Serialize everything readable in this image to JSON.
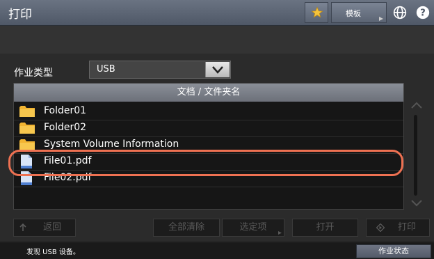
{
  "title": "打印",
  "toolbar": {
    "star_icon": "star-icon",
    "template_label": "模板",
    "globe_icon": "globe-icon",
    "help_icon": "help-icon"
  },
  "job_type": {
    "label": "作业类型",
    "value": "USB"
  },
  "file_list": {
    "header": "文档 / 文件夹名",
    "items": [
      {
        "name": "Folder01",
        "type": "folder"
      },
      {
        "name": "Folder02",
        "type": "folder"
      },
      {
        "name": "System Volume Information",
        "type": "folder"
      },
      {
        "name": "File01.pdf",
        "type": "file",
        "highlighted": true
      },
      {
        "name": "File02.pdf",
        "type": "file"
      }
    ]
  },
  "buttons": {
    "back": "返回",
    "clear_all": "全部清除",
    "selected_items": "选定项",
    "open": "打开",
    "print": "打印"
  },
  "status": {
    "message": "发现 USB 设备。",
    "job_status_button": "作业状态"
  },
  "colors": {
    "highlight": "#ee7152",
    "folder": "#f2b431",
    "title_bar": "#5b6473"
  }
}
